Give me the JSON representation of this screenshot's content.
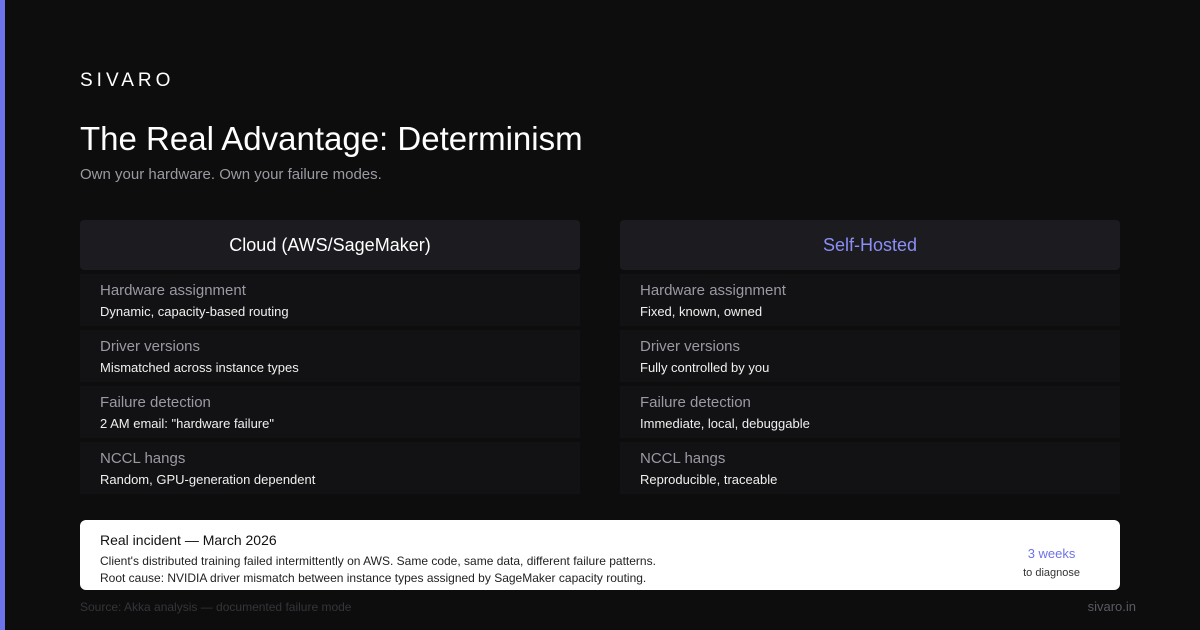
{
  "brand": "SIVARO",
  "title": "The Real Advantage: Determinism",
  "subtitle": "Own your hardware. Own your failure modes.",
  "comparison": {
    "cloud": {
      "heading": "Cloud (AWS/SageMaker)",
      "rows": [
        {
          "label": "Hardware assignment",
          "value": "Dynamic, capacity-based routing"
        },
        {
          "label": "Driver versions",
          "value": "Mismatched across instance types"
        },
        {
          "label": "Failure detection",
          "value": "2 AM email: \"hardware failure\""
        },
        {
          "label": "NCCL hangs",
          "value": "Random, GPU-generation dependent"
        }
      ]
    },
    "self_hosted": {
      "heading": "Self-Hosted",
      "rows": [
        {
          "label": "Hardware assignment",
          "value": "Fixed, known, owned"
        },
        {
          "label": "Driver versions",
          "value": "Fully controlled by you"
        },
        {
          "label": "Failure detection",
          "value": "Immediate, local, debuggable"
        },
        {
          "label": "NCCL hangs",
          "value": "Reproducible, traceable"
        }
      ]
    }
  },
  "incident": {
    "title": "Real incident — March 2026",
    "line1": "Client's distributed training failed intermittently on AWS. Same code, same data, different failure patterns.",
    "line2": "Root cause: NVIDIA driver mismatch between instance types assigned by SageMaker capacity routing.",
    "metric_value": "3 weeks",
    "metric_label": "to diagnose"
  },
  "footer": {
    "source": "Source: Akka analysis — documented failure mode",
    "site": "sivaro.in"
  },
  "colors": {
    "accent": "#6d73e8",
    "background": "#0d0d0d",
    "self_hosted_heading": "#8b8ff5"
  }
}
